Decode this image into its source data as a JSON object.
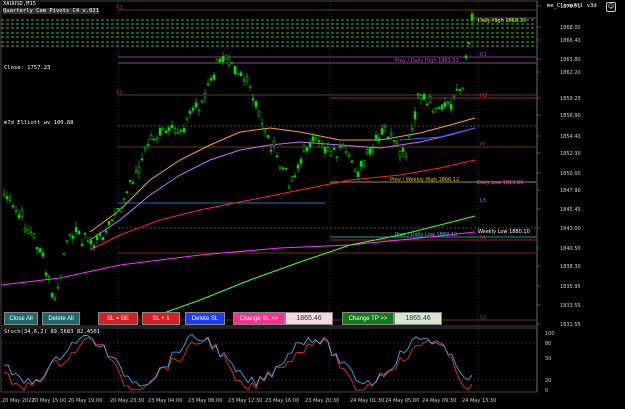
{
  "symbol_title": "XAUUSD,M15",
  "indicator_title": "Quarterly Cam Pivots C4 v.021",
  "overlay_left": [
    "Close: 1757.23"
  ],
  "overlay_left2": "m7d Elliott wv 100.88",
  "ea_name": "me_CloseAll v3d",
  "price_axis": [
    "1870.70",
    "1868.00",
    "1866.40",
    "1863.80",
    "1862.20",
    "1859.25",
    "1856.90",
    "1854.40",
    "1852.30",
    "1850.00",
    "1847.90",
    "1845.45",
    "1843.00",
    "1840.50",
    "1838.30",
    "1835.95",
    "1833.55",
    "1831.55"
  ],
  "time_axis": [
    "20 May 2022",
    "20 May 15:00",
    "20 May 19:00",
    "20 May 23:30",
    "23 May 04:00",
    "23 May 08:00",
    "23 May 12:30",
    "23 May 16:00",
    "23 May 20:30",
    "24 May 01:30",
    "24 May 05:00",
    "24 May 09:30",
    "24 May 13:30"
  ],
  "level_labels": {
    "prev_daily_high": "Prev / Daily High 1863.33",
    "daily_high": "Daily High 1868.33",
    "prev_weekly_high": "Prev / Weekly High 1866.12",
    "daily_low": "Daily Low 1813.86",
    "prev_daily_low": "Prev / Daily Low 1880.10",
    "weekly_low": "Weekly Low 1880.10",
    "pp": "PP",
    "r1": "R1",
    "r2": "R2",
    "r3": "R3",
    "h3": "H3",
    "l3": "L3",
    "s1": "S1",
    "s2": "S2"
  },
  "buttons": {
    "close_all": "Close All",
    "delete_all": "Delete All",
    "sl_be": "SL = BE",
    "sl_plus1": "SL + 1",
    "delete_sl": "Delete SL",
    "change_sl": "Change SL >>",
    "sl_value": "1865.46",
    "change_tp": "Change TP >>",
    "tp_value": "1865.46"
  },
  "stoch_title": "Stoch(34,6,2) 89.5683 82.4501",
  "stoch_axis": [
    "100",
    "80",
    "50",
    "20",
    "0"
  ],
  "colors": {
    "candle": "#00e000",
    "ma_orange": "#ffa020",
    "ma_purple": "#c070ff",
    "ma_red": "#ff2020",
    "ma_green": "#40ff40",
    "ma_magenta": "#ff30ff",
    "stoch_main": "#4ab0ff",
    "stoch_signal": "#ff3030"
  }
}
